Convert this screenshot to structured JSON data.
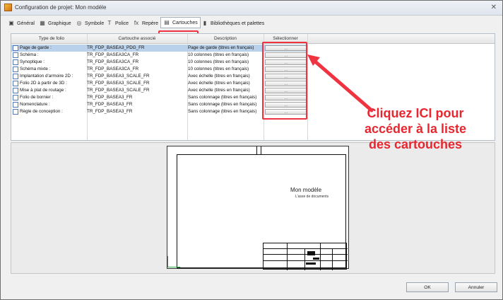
{
  "window": {
    "title": "Configuration de projet: Mon modèle",
    "close_symbol": "✕"
  },
  "tabs": [
    {
      "label": "Général",
      "icon": "general-icon",
      "glyph": "▣"
    },
    {
      "label": "Graphique",
      "icon": "graphics-icon",
      "glyph": "▦"
    },
    {
      "label": "Symbole",
      "icon": "symbol-icon",
      "glyph": "◎"
    },
    {
      "label": "Police",
      "icon": "font-icon",
      "glyph": "T"
    },
    {
      "label": "Repère",
      "icon": "formula-icon",
      "glyph": "fx"
    },
    {
      "label": "Cartouches",
      "icon": "title-block-icon",
      "glyph": "▤"
    },
    {
      "label": "Bibliothèques et palettes",
      "icon": "library-icon",
      "glyph": "▮"
    }
  ],
  "table": {
    "headers": [
      "Type de folio",
      "Cartouche associé",
      "Description",
      "Sélectionner"
    ],
    "button_label": "...",
    "rows": [
      {
        "type": "Page de garde :",
        "cartouche": "TR_FDP_BASEA3_PDG_FR",
        "description": "Page de garde (titres en français)"
      },
      {
        "type": "Schéma :",
        "cartouche": "TR_FDP_BASEA3CA_FR",
        "description": "10 colonnes (titres en français)"
      },
      {
        "type": "Synoptique :",
        "cartouche": "TR_FDP_BASEA3CA_FR",
        "description": "10 colonnes (titres en français)"
      },
      {
        "type": "Schéma mixte :",
        "cartouche": "TR_FDP_BASEA3CA_FR",
        "description": "10 colonnes (titres en français)"
      },
      {
        "type": "Implantation d'armoire 2D :",
        "cartouche": "TR_FDP_BASEA3_SCALE_FR",
        "description": "Avec échelle (titres en français)"
      },
      {
        "type": "Folio 2D à partir de 3D :",
        "cartouche": "TR_FDP_BASEA3_SCALE_FR",
        "description": "Avec échelle (titres en français)"
      },
      {
        "type": "Mise à plat de routage :",
        "cartouche": "TR_FDP_BASEA3_SCALE_FR",
        "description": "Avec échelle (titres en français)"
      },
      {
        "type": "Folio de bornier :",
        "cartouche": "TR_FDP_BASEA3_FR",
        "description": "Sans colonnage (titres en français)"
      },
      {
        "type": "Nomenclature :",
        "cartouche": "TR_FDP_BASEA3_FR",
        "description": "Sans colonnage (titres en français)"
      },
      {
        "type": "Règle de conception :",
        "cartouche": "TR_FDP_BASEA3_FR",
        "description": "Sans colonnage (titres en français)"
      }
    ]
  },
  "preview": {
    "title": "Mon modèle",
    "subtitle": "L'asse de documents"
  },
  "annotation": {
    "lines": [
      "Cliquez ICI pour",
      "accéder à la liste",
      "des cartouches"
    ],
    "color": "#e8262f"
  },
  "footer": {
    "ok_label": "OK",
    "cancel_label": "Annuler"
  },
  "colors": {
    "selection": "#b9d1ea",
    "highlight": "#ef3340"
  }
}
